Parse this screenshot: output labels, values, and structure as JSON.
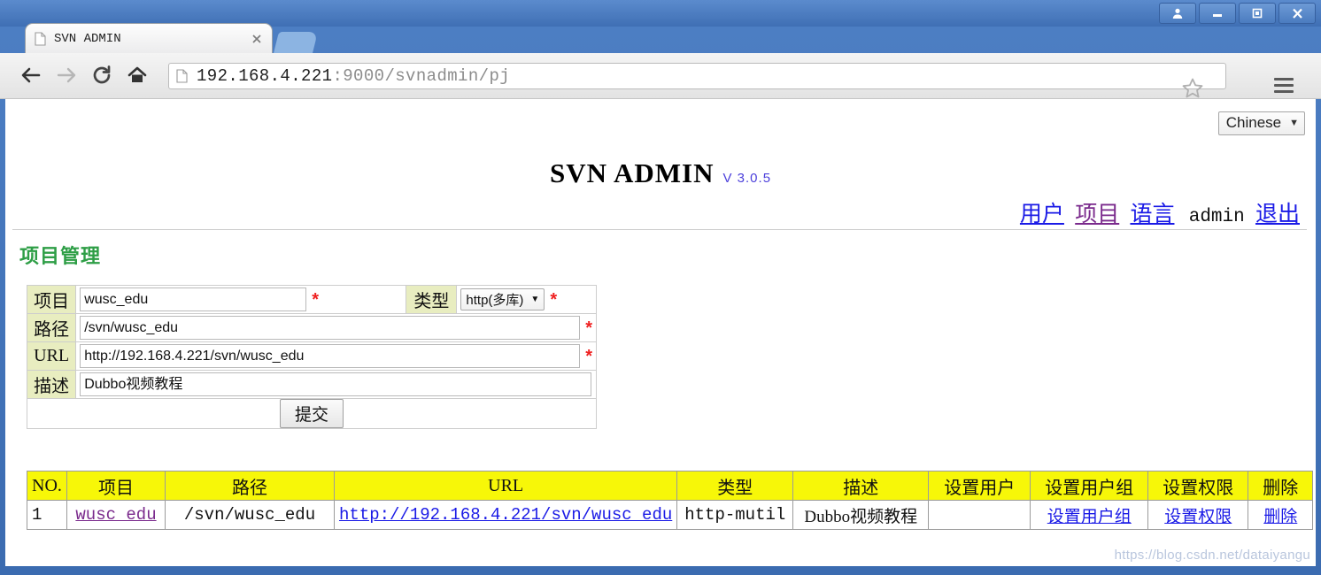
{
  "browser": {
    "tab": {
      "title": "SVN ADMIN",
      "favicon_icon": "page-icon",
      "close_icon": "close-icon"
    },
    "new_tab_icon": "new-tab-icon",
    "window_controls": {
      "user_icon": "user-icon",
      "minimize_icon": "minimize-icon",
      "maximize_icon": "maximize-icon",
      "close_icon": "close-icon"
    },
    "nav": {
      "back_icon": "back-arrow-icon",
      "forward_icon": "forward-arrow-icon",
      "reload_icon": "reload-icon",
      "home_icon": "home-icon"
    },
    "omnibox": {
      "page_icon": "page-icon",
      "host": "192.168.4.221",
      "path": ":9000/svnadmin/pj",
      "bookmark_icon": "star-icon"
    },
    "menu_icon": "hamburger-menu-icon"
  },
  "page": {
    "language_select": {
      "value": "Chinese",
      "caret": "▼"
    },
    "app_title": "SVN ADMIN",
    "app_version": "V 3.0.5",
    "topnav": [
      {
        "label": "用户",
        "state": "link"
      },
      {
        "label": "项目",
        "state": "visited"
      },
      {
        "label": "语言",
        "state": "link"
      },
      {
        "label": "admin",
        "state": "plain"
      },
      {
        "label": "退出",
        "state": "link"
      }
    ],
    "section_title": "项目管理",
    "form": {
      "project_label": "项目",
      "project_value": "wusc_edu",
      "type_label": "类型",
      "type_value": "http(多库)",
      "type_caret": "▼",
      "path_label": "路径",
      "path_value": "/svn/wusc_edu",
      "url_label": "URL",
      "url_value": "http://192.168.4.221/svn/wusc_edu",
      "desc_label": "描述",
      "desc_value": "Dubbo视频教程",
      "required_mark": "*",
      "submit_label": "提交"
    },
    "table": {
      "columns": [
        "NO.",
        "项目",
        "路径",
        "URL",
        "类型",
        "描述",
        "设置用户",
        "设置用户组",
        "设置权限",
        "删除"
      ],
      "rows": [
        {
          "no": "1",
          "project": "wusc_edu",
          "path": "/svn/wusc_edu",
          "url": "http://192.168.4.221/svn/wusc_edu",
          "type": "http-mutil",
          "desc": "Dubbo视频教程",
          "set_user": "",
          "set_user_group": "设置用户组",
          "set_permission": "设置权限",
          "delete": "删除"
        }
      ]
    },
    "watermark": "https://blog.csdn.net/dataiyangu"
  },
  "colors": {
    "header_yellow": "#f7f708",
    "label_green": "#e8edc0",
    "title_green": "#2e9e46",
    "link_blue": "#1a1ae6",
    "link_visited": "#7a2a8c",
    "required_red": "#ef2020",
    "version_blue": "#4b3fdb"
  }
}
